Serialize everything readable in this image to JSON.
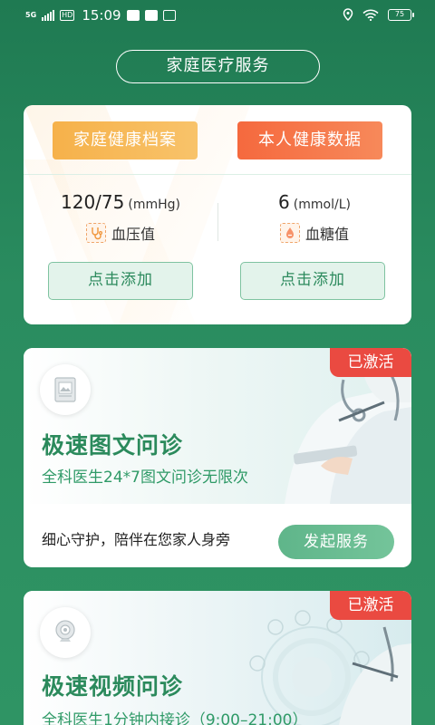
{
  "status_bar": {
    "network": "5G",
    "hd": "HD",
    "time": "15:09",
    "battery": "75"
  },
  "page_title": "家庭医疗服务",
  "health_card": {
    "archive_button": "家庭健康档案",
    "data_button": "本人健康数据",
    "blood_pressure": {
      "value": "120/75",
      "unit": "(mmHg)",
      "label": "血压值",
      "add": "点击添加"
    },
    "blood_sugar": {
      "value": "6",
      "unit": "(mmol/L)",
      "label": "血糖值",
      "add": "点击添加"
    }
  },
  "services": [
    {
      "badge": "已激活",
      "title": "极速图文问诊",
      "subtitle": "全科医生24*7图文问诊无限次",
      "tagline": "细心守护，陪伴在您家人身旁",
      "action": "发起服务"
    },
    {
      "badge": "已激活",
      "title": "极速视频问诊",
      "subtitle": "全科医生1分钟内接诊（9:00–21:00）"
    }
  ],
  "colors": {
    "background": "#1f7a52",
    "accent_green": "#2b8a5c",
    "orange": "#f6b14a",
    "red_orange": "#f5693e",
    "badge_red": "#ea4a41"
  },
  "icons": [
    "signal-icon",
    "message-icon",
    "mail-icon",
    "location-icon",
    "wifi-icon",
    "battery-icon",
    "stethoscope-icon",
    "blood-drop-icon",
    "document-image-icon",
    "webcam-icon"
  ]
}
